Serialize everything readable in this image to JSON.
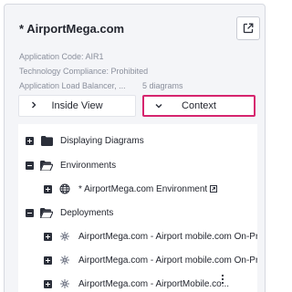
{
  "header": {
    "title": "* AirportMega.com",
    "application_code": "Application Code: AIR1",
    "technology_compliance": "Technology Compliance: Prohibited",
    "application_load_balancer": "Application Load Balancer, ...",
    "diagram_count": "5 diagrams"
  },
  "toggle": {
    "inside_view_label": "Inside View",
    "context_label": "Context"
  },
  "tree": {
    "displaying_diagrams": "Displaying Diagrams",
    "environments": "Environments",
    "environment_item": "* AirportMega.com Environment",
    "deployments": "Deployments",
    "deployment_1": "AirportMega.com - Airport mobile.com On-Pre",
    "deployment_2": "AirportMega.com - Airport mobile.com On-Pre",
    "deployment_3": "AirportMega.com - AirportMobile.co..."
  },
  "colors": {
    "accent_border": "#d6246e",
    "panel_bg": "#f4f5f8",
    "text": "#23262f",
    "muted": "#8a8f9c"
  }
}
